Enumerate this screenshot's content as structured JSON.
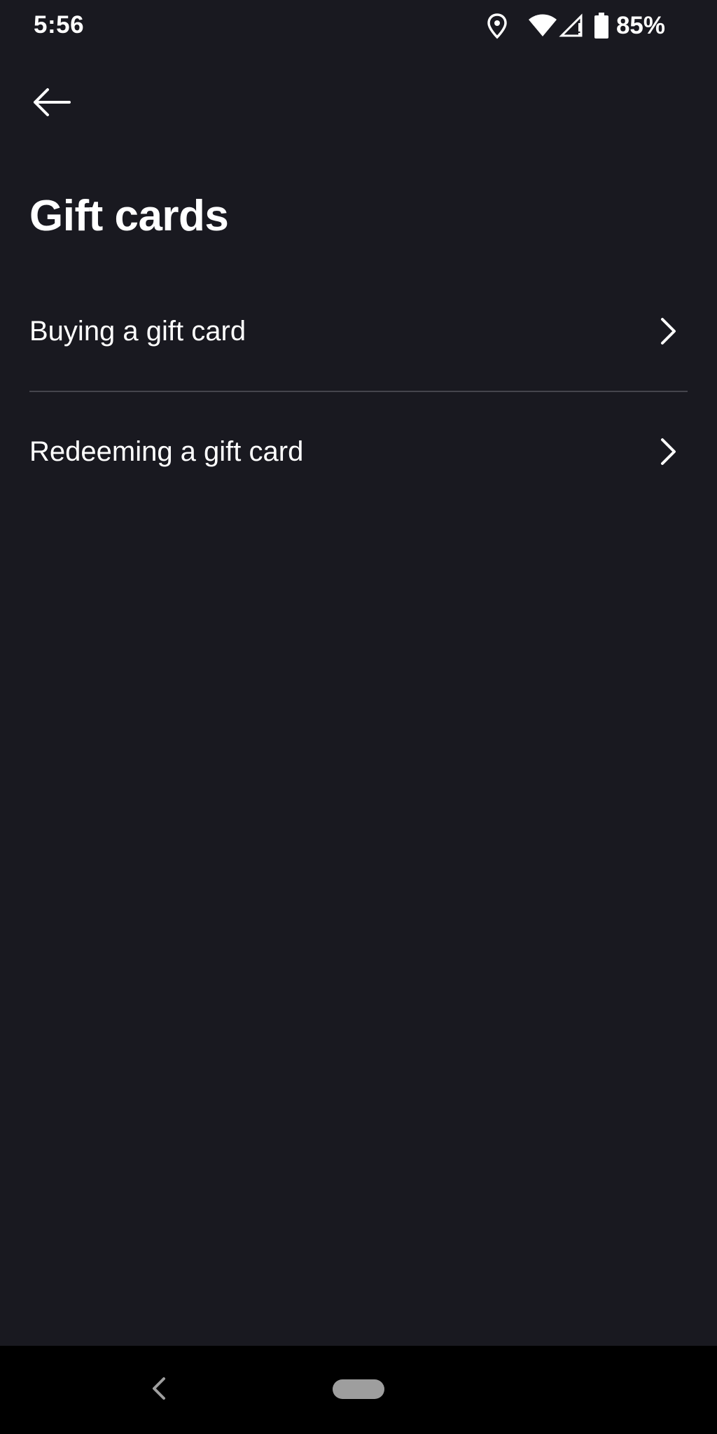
{
  "status_bar": {
    "time": "5:56",
    "battery_percent": "85%",
    "icons": [
      "location-icon",
      "wifi-icon",
      "cell-signal-icon",
      "battery-icon"
    ]
  },
  "header": {
    "back_icon": "arrow-left-icon"
  },
  "page": {
    "title": "Gift cards"
  },
  "menu": {
    "items": [
      {
        "label": "Buying a gift card",
        "icon": "chevron-right-icon"
      },
      {
        "label": "Redeeming a gift card",
        "icon": "chevron-right-icon"
      }
    ]
  },
  "nav_bar": {
    "back_icon": "nav-back-icon",
    "home_icon": "home-pill"
  },
  "colors": {
    "background": "#191920",
    "text": "#ffffff",
    "divider": "#45454d",
    "nav_background": "#000000",
    "home_pill": "#9e9e9e"
  }
}
